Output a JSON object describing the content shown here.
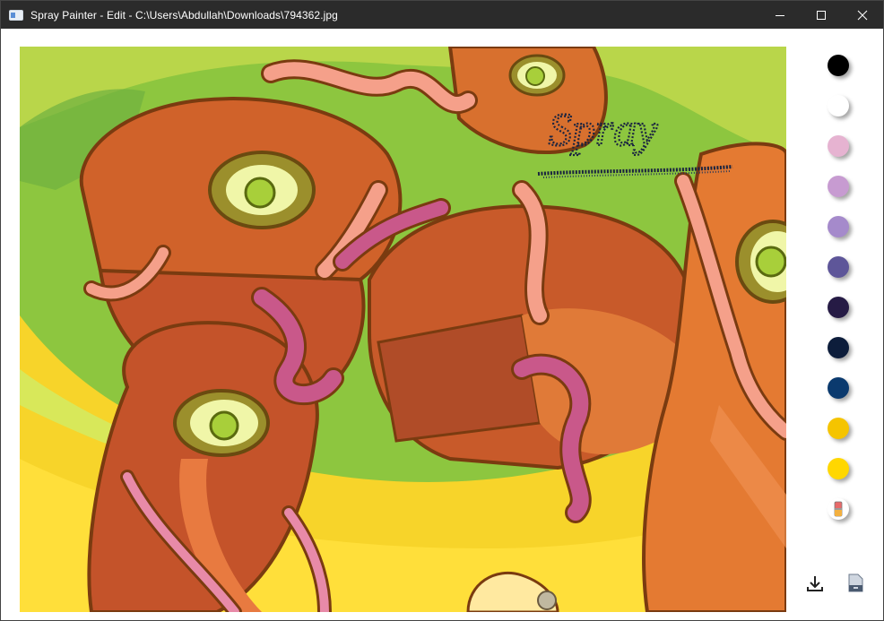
{
  "window": {
    "title": "Spray Painter - Edit - C:\\Users\\Abdullah\\Downloads\\794362.jpg",
    "minimize_glyph": "—",
    "maximize_glyph": "☐",
    "close_glyph": "✕"
  },
  "canvas": {
    "spray_text": "Spray"
  },
  "palette": {
    "colors": [
      "#000000",
      "#ffffff",
      "#e6b3d1",
      "#c79bd1",
      "#a58acb",
      "#5e5699",
      "#261b45",
      "#0d1d3b",
      "#0b3a6e",
      "#f5c400",
      "#ffd700"
    ],
    "selected_color": "#0d1d3b",
    "eraser_icon": "eraser-icon"
  },
  "actions": {
    "download_icon": "download-icon",
    "save_icon": "save-disk-icon"
  }
}
